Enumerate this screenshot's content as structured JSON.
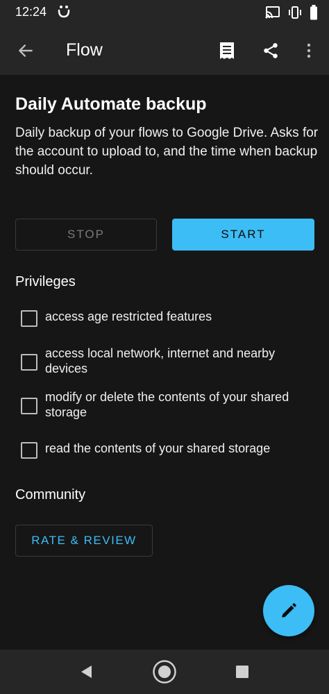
{
  "status_bar": {
    "time": "12:24",
    "icons": [
      "smiley-icon",
      "cast-icon",
      "vibrate-icon",
      "battery-icon"
    ]
  },
  "app_bar": {
    "title": "Flow",
    "back_icon": "arrow-left-icon",
    "actions": [
      "receipt-icon",
      "share-icon",
      "more-vert-icon"
    ]
  },
  "flow": {
    "title": "Daily Automate backup",
    "description": "Daily backup of your flows to Google Drive. Asks for the account to upload to, and the time when backup should occur."
  },
  "buttons": {
    "stop_label": "STOP",
    "start_label": "START"
  },
  "privileges": {
    "heading": "Privileges",
    "items": [
      {
        "label": "access age restricted features",
        "checked": false
      },
      {
        "label": "access local network, internet and nearby devices",
        "checked": false
      },
      {
        "label": "modify or delete the contents of your shared storage",
        "checked": false
      },
      {
        "label": "read the contents of your shared storage",
        "checked": false
      }
    ]
  },
  "community": {
    "heading": "Community",
    "rate_label": "RATE & REVIEW"
  },
  "fab": {
    "icon": "pencil-icon"
  },
  "nav_bar": {
    "icons": [
      "back-triangle-icon",
      "home-circle-icon",
      "recents-square-icon"
    ]
  },
  "colors": {
    "accent": "#3dbdf5",
    "background": "#161616",
    "bar": "#262626"
  }
}
